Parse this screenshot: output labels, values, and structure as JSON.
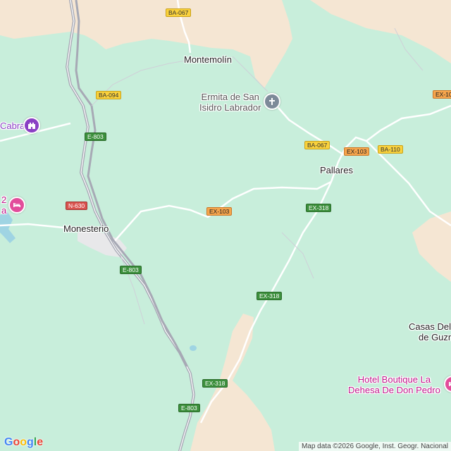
{
  "map": {
    "colors": {
      "terrain": "#c8eedb",
      "sand": "#f5e6d3",
      "water": "#9fd4e3",
      "highway": "#a7a9b5",
      "road": "#ffffff"
    },
    "places": {
      "montemolin": "Montemolín",
      "ermita_line1": "Ermita de San",
      "ermita_line2": "Isidro Labrador",
      "cabra": "Cabra",
      "pallares": "Pallares",
      "monesterio": "Monesterio",
      "partial_left_1": "2",
      "partial_left_2": "a",
      "casas_line1": "Casas Del",
      "casas_line2": "de Guzm",
      "hotel_line1": "Hotel Boutique La",
      "hotel_line2": "Dehesa De Don Pedro"
    },
    "road_shields": {
      "ba067_top": "BA-067",
      "ba094": "BA-094",
      "e803_upper": "E-803",
      "n630": "N-630",
      "ex103_center": "EX-103",
      "ba067_mid": "BA-067",
      "ex103_right": "EX-103",
      "ba110": "BA-110",
      "ex10_partial": "EX-10",
      "ex318_upper": "EX-318",
      "e803_middle": "E-803",
      "ex318_middle": "EX-318",
      "ex318_lower": "EX-318",
      "e803_lower": "E-803"
    },
    "icons": {
      "ermita": "cross-icon",
      "cabra": "castle-icon",
      "hotel_left": "bed-icon",
      "hotel_right": "bed-icon"
    },
    "footer": {
      "logo_g": "G",
      "logo_o1": "o",
      "logo_o2": "o",
      "logo_g2": "g",
      "logo_l": "l",
      "logo_e": "e",
      "attribution": "Map data ©2026 Google, Inst. Geogr. Nacional"
    }
  }
}
